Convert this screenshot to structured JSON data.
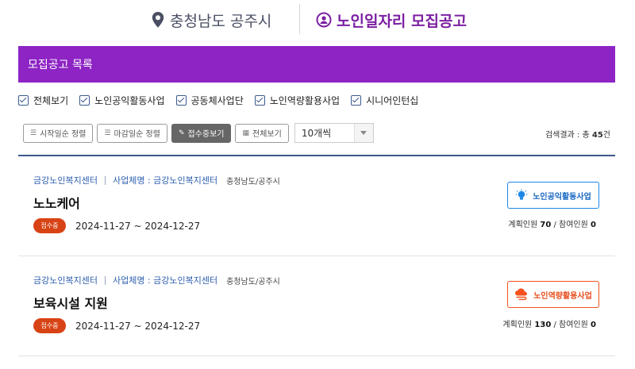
{
  "header": {
    "region": "충청남도 공주시",
    "title": "노인일자리 모집공고"
  },
  "list_bar": {
    "title": "모집공고 목록"
  },
  "filters": [
    {
      "label": "전체보기",
      "checked": true
    },
    {
      "label": "노인공익활동사업",
      "checked": true
    },
    {
      "label": "공동체사업단",
      "checked": true
    },
    {
      "label": "노인역량활용사업",
      "checked": true
    },
    {
      "label": "시니어인턴십",
      "checked": true
    }
  ],
  "toolbar": {
    "sort_start": "시작일순 정렬",
    "sort_end": "마감일순 정렬",
    "view_open": "접수중보기",
    "view_all": "전체보기",
    "page_size": "10개씩"
  },
  "result": {
    "prefix": "검색결과 : 총",
    "count": "45",
    "suffix": "건"
  },
  "items": [
    {
      "org": "금강노인복지센터",
      "project": "사업체명 : 금강노인복지센터",
      "location": "충청남도/공주시",
      "title": "노노케어",
      "status": "접수중",
      "period": "2024-11-27 ~ 2024-12-27",
      "category": "노인공익활동사업",
      "planned_label": "계획인원",
      "planned": "70",
      "joined_label": "참여인원",
      "joined": "0"
    },
    {
      "org": "금강노인복지센터",
      "project": "사업체명 : 금강노인복지센터",
      "location": "충청남도/공주시",
      "title": "보육시설 지원",
      "status": "접수중",
      "period": "2024-11-27 ~ 2024-12-27",
      "category": "노인역량활용사업",
      "planned_label": "계획인원",
      "planned": "130",
      "joined_label": "참여인원",
      "joined": "0"
    }
  ],
  "colors": {
    "accent_purple": "#8e24c4",
    "title_purple": "#7b1fa2",
    "status_badge": "#d84315",
    "tag_blue": "#1e88e5",
    "tag_orange": "#f4511e"
  },
  "icons": {
    "region": "location-pin-icon",
    "notice": "person-circle-icon",
    "tag_public": "lightbulb-icon",
    "tag_capacity": "cloud-hand-icon"
  }
}
